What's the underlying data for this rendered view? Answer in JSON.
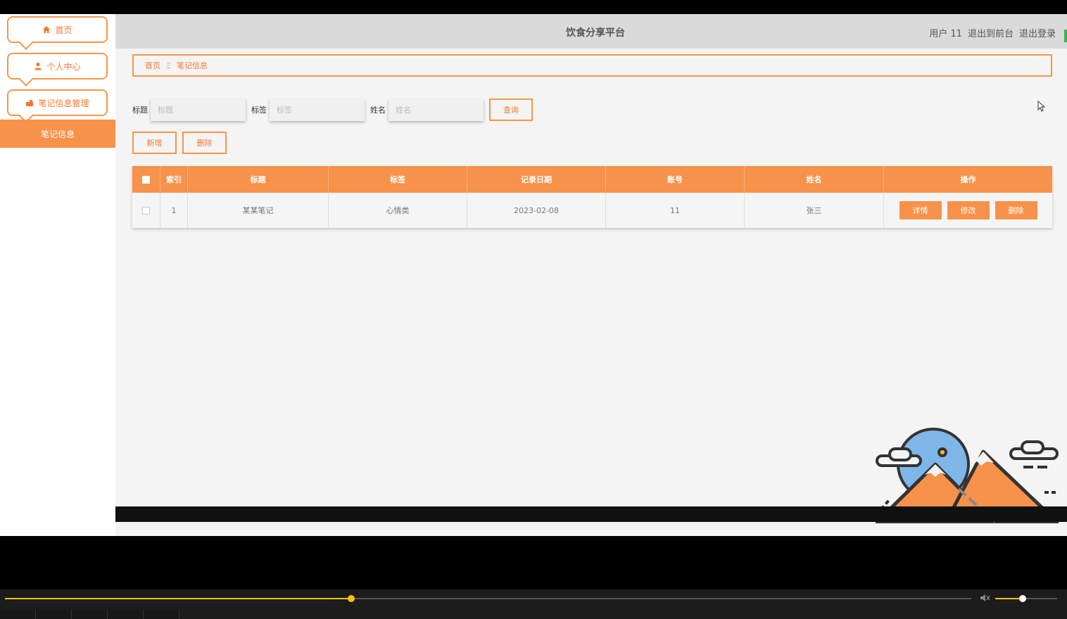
{
  "topbar": {
    "title": "饮食分享平台",
    "user": "用户 11",
    "to_front": "退出到前台",
    "logout": "退出登录"
  },
  "sidebar": {
    "items": [
      {
        "label": "首页",
        "icon": "home-icon"
      },
      {
        "label": "个人中心",
        "icon": "user-icon"
      },
      {
        "label": "笔记信息管理",
        "icon": "note-icon"
      }
    ],
    "active": "笔记信息"
  },
  "breadcrumb": {
    "home": "首页",
    "separator": "Ξ",
    "current": "笔记信息"
  },
  "search": {
    "title_label": "标题",
    "title_placeholder": "标题",
    "tag_label": "标签",
    "tag_placeholder": "标签",
    "name_label": "姓名",
    "name_placeholder": "姓名",
    "query_button": "查询"
  },
  "actions": {
    "add": "新增",
    "delete": "删除"
  },
  "table": {
    "headers": [
      "索引",
      "标题",
      "标签",
      "记录日期",
      "账号",
      "姓名",
      "操作"
    ],
    "rows": [
      {
        "index": "1",
        "title": "某某笔记",
        "tag": "心情类",
        "date": "2023-02-08",
        "account": "11",
        "name": "张三"
      }
    ],
    "ops": [
      "详情",
      "修改",
      "删除"
    ]
  },
  "player": {
    "progress": 0.358,
    "volume": 0.44
  },
  "colors": {
    "accent": "#f7924a",
    "accent_border": "#f79646",
    "progress": "#f5c400"
  }
}
